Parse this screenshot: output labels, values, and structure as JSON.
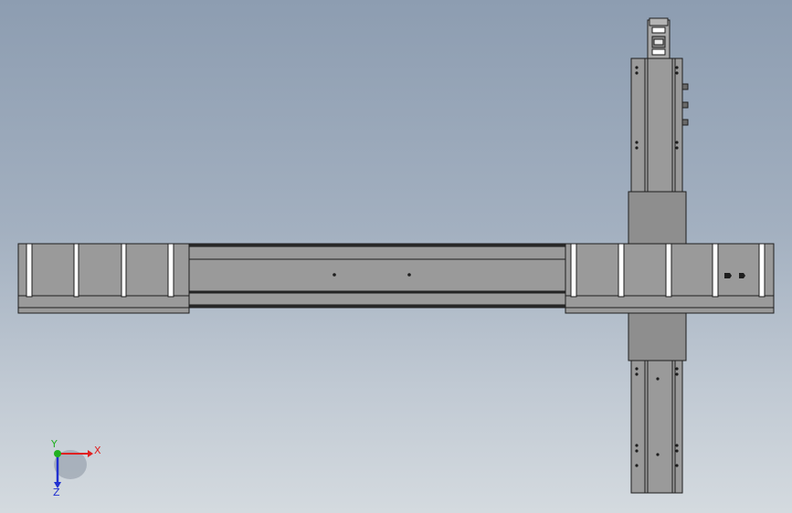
{
  "viewport": {
    "background_top": "#8d9db1",
    "background_bottom": "#d4dadf"
  },
  "model": {
    "part_fill": "#9a9a9a",
    "part_fill_dark": "#8e8e8e",
    "edge_color": "#1e1e1e",
    "highlight_color": "#ffffff"
  },
  "triad": {
    "x_label": "X",
    "y_label": "Y",
    "z_label": "Z",
    "x_color": "#e02020",
    "y_color": "#20b020",
    "z_color": "#2030d0"
  }
}
